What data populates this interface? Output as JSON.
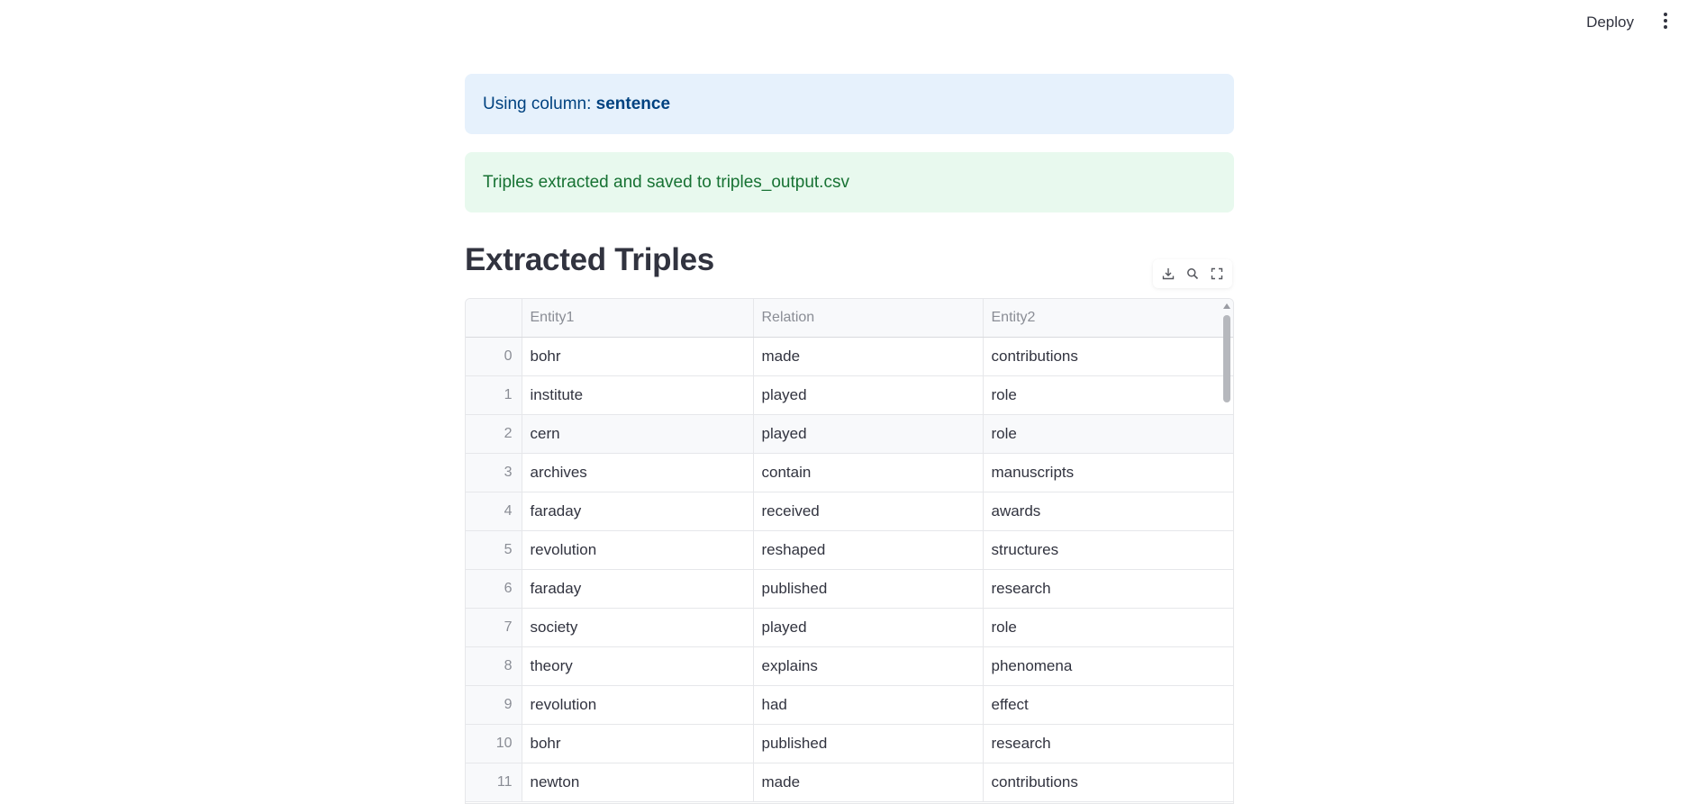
{
  "header": {
    "deploy_label": "Deploy",
    "menu_icon": "kebab-menu-icon"
  },
  "info_alert": {
    "prefix": "Using column: ",
    "column": "sentence"
  },
  "success_alert": {
    "text": "Triples extracted and saved to triples_output.csv"
  },
  "section": {
    "title": "Extracted Triples"
  },
  "toolbar": {
    "download_icon": "download-icon",
    "search_icon": "search-icon",
    "fullscreen_icon": "fullscreen-icon"
  },
  "table": {
    "columns": [
      "",
      "Entity1",
      "Relation",
      "Entity2"
    ],
    "rows": [
      {
        "index": "0",
        "entity1": "bohr",
        "relation": "made",
        "entity2": "contributions"
      },
      {
        "index": "1",
        "entity1": "institute",
        "relation": "played",
        "entity2": "role"
      },
      {
        "index": "2",
        "entity1": "cern",
        "relation": "played",
        "entity2": "role"
      },
      {
        "index": "3",
        "entity1": "archives",
        "relation": "contain",
        "entity2": "manuscripts"
      },
      {
        "index": "4",
        "entity1": "faraday",
        "relation": "received",
        "entity2": "awards"
      },
      {
        "index": "5",
        "entity1": "revolution",
        "relation": "reshaped",
        "entity2": "structures"
      },
      {
        "index": "6",
        "entity1": "faraday",
        "relation": "published",
        "entity2": "research"
      },
      {
        "index": "7",
        "entity1": "society",
        "relation": "played",
        "entity2": "role"
      },
      {
        "index": "8",
        "entity1": "theory",
        "relation": "explains",
        "entity2": "phenomena"
      },
      {
        "index": "9",
        "entity1": "revolution",
        "relation": "had",
        "entity2": "effect"
      },
      {
        "index": "10",
        "entity1": "bohr",
        "relation": "published",
        "entity2": "research"
      },
      {
        "index": "11",
        "entity1": "newton",
        "relation": "made",
        "entity2": "contributions"
      }
    ]
  }
}
